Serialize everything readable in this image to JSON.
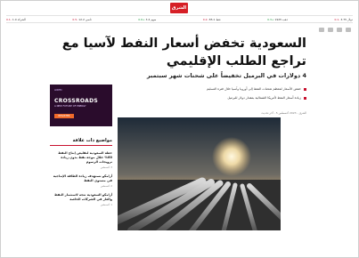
{
  "logo": "الشرق",
  "ticker": [
    {
      "name": "الشركة",
      "value": "1.0",
      "change": "-0.1"
    },
    {
      "name": "تاسي",
      "value": "12.2",
      "change": "-0.5"
    },
    {
      "name": "سهم",
      "value": "3.4",
      "change": "+0.6",
      "up": true
    },
    {
      "name": "نفط",
      "value": "85.1",
      "change": "-0.2"
    },
    {
      "name": "ذهب",
      "value": "1925",
      "change": "+0.3",
      "up": true
    },
    {
      "name": "دولار",
      "value": "3.75",
      "change": "-0.1"
    }
  ],
  "article": {
    "headline": "السعودية تخفض أسعار النفط لآسيا مع تراجع الطلب الإقليمي",
    "subhead": "4 دولارات في البرميل تخفيضاً على شحنات شهر سبتمبر",
    "bullets": [
      "خفض الأسعار لمعظم شحنات النفط إلى أوروبا وآسيا خلال فترة التسليم",
      "زيادة أسعار النفط لأمريكا الشمالية بمقدار دولار للبرميل"
    ],
    "meta": "الشرق - 2023 أغسطس 5 - آخر تحديث"
  },
  "ad": {
    "top_label": "ADIPEC",
    "title": "CROSSROADS",
    "subtitle": "A NEW FUTURE OF ENERGY",
    "button": "REGISTER"
  },
  "related": {
    "heading": "مواضيع ذات علاقة",
    "items": [
      {
        "title": "خطة السعودية لتقليص إنتاج النفط 60% خلال موجة نفط بدون زيادة ترويجات الرسوم",
        "date": "3 أغسطس"
      },
      {
        "title": "أرامكو تستهدف زيادة الطاقة الإنتاجية في مستوى النفط",
        "date": "2 أغسطس"
      },
      {
        "title": "أرامكو السعودية تتجه لاستثمار النفط والغاز في الشركات الخاصة",
        "date": "1 أغسطس"
      }
    ]
  }
}
